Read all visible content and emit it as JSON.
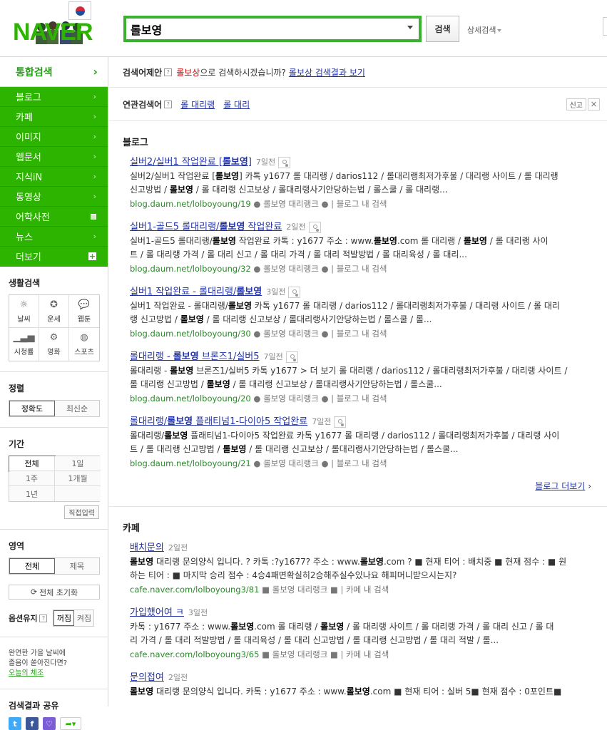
{
  "logo": {
    "text": "NAVER"
  },
  "search": {
    "value": "롤보영",
    "button": "검색",
    "detail": "상세검색"
  },
  "sidebar": {
    "head": "통합검색",
    "nav": [
      {
        "label": "블로그",
        "mark": "chevron"
      },
      {
        "label": "카페",
        "mark": "chevron"
      },
      {
        "label": "이미지",
        "mark": "chevron"
      },
      {
        "label": "웹문서",
        "mark": "chevron"
      },
      {
        "label": "지식iN",
        "mark": "chevron"
      },
      {
        "label": "동영상",
        "mark": "chevron"
      },
      {
        "label": "어학사전",
        "mark": "square"
      },
      {
        "label": "뉴스",
        "mark": "chevron"
      },
      {
        "label": "더보기",
        "mark": "plus"
      }
    ],
    "life_title": "생활검색",
    "life": [
      {
        "label": "날씨",
        "icon": "sun-icon",
        "glyph": "☼"
      },
      {
        "label": "운세",
        "icon": "star-icon",
        "glyph": "✪"
      },
      {
        "label": "웹툰",
        "icon": "speech-icon",
        "glyph": "💬"
      },
      {
        "label": "시청률",
        "icon": "bar-chart-icon",
        "glyph": "▁▃▅"
      },
      {
        "label": "영화",
        "icon": "film-reel-icon",
        "glyph": "⚙"
      },
      {
        "label": "스포츠",
        "icon": "ball-icon",
        "glyph": "◍"
      }
    ],
    "sort_title": "정렬",
    "sort": [
      "정확도",
      "최신순"
    ],
    "period_title": "기간",
    "period": [
      "전체",
      "1일",
      "1주",
      "1개월",
      "1년",
      ""
    ],
    "direct_input": "직접입력",
    "area_title": "영역",
    "area": [
      "전체",
      "제목"
    ],
    "reset": "전체 초기화",
    "keep_label": "옵션유지",
    "keep": [
      "꺼짐",
      "켜짐"
    ],
    "promo_line1": "완연한 가을 날씨에",
    "promo_line2": "졸음이 쏟아진다면?",
    "promo_link": "오늘의 체조",
    "share_title": "검색결과 공유"
  },
  "suggest": {
    "label": "검색어제안",
    "keyword": "롤보상",
    "text": "으로 검색하시겠습니까?",
    "link": "롤보상 검색결과 보기"
  },
  "related": {
    "label": "연관검색어",
    "keywords": [
      "롤 대리랭",
      "롤 대리"
    ],
    "report": "신고"
  },
  "blog": {
    "title": "블로그",
    "more": "블로그 더보기",
    "items": [
      {
        "title": "실버2/실버1 작업완료 [롤보영]",
        "age": "7일전",
        "desc1": "실버2/실버1 작업완료 [롤보영] 카톡 y1677 롤 대리랭 / darios112 / 롤대리랭최저가후불 / 대리랭 사이트 / 롤 대리랭",
        "desc2": "신고방법 / 롤보영 / 롤 대리랭 신고보상 / 롤대리랭사기안당하는법 / 롤스쿨 / 롤 대리랭...",
        "url": "blog.daum.net/lolboyoung/19",
        "tag": "롤보영 대리랭크",
        "inner": "블로그 내 검색"
      },
      {
        "title": "실버1-골드5 롤대리랭/롤보영 작업완료",
        "age": "2일전",
        "desc1": "실버1-골드5 롤대리랭/롤보영 작업완료 카톡 : y1677 주소 : www.롤보영.com 롤 대리랭 / 롤보영 / 롤 대리랭 사이",
        "desc2": "트 / 롤 대리랭 가격 / 롤 대리 신고 / 롤 대리 가격 / 롤 대리 적발방법 / 롤 대리육성 / 롤 대리...",
        "url": "blog.daum.net/lolboyoung/32",
        "tag": "롤보영 대리랭크",
        "inner": "블로그 내 검색"
      },
      {
        "title": "실버1 작업완료 - 롤대리랭/롤보영",
        "age": "3일전",
        "desc1": "실버1 작업완료 - 롤대리랭/롤보영 카톡 y1677 롤 대리랭 / darios112 / 롤대리랭최저가후불 / 대리랭 사이트 / 롤 대리",
        "desc2": "랭 신고방법 / 롤보영 / 롤 대리랭 신고보상 / 롤대리랭사기안당하는법 / 롤스쿨 / 롤...",
        "url": "blog.daum.net/lolboyoung/30",
        "tag": "롤보영 대리랭크",
        "inner": "블로그 내 검색"
      },
      {
        "title": "롤대리랭 - 롤보영 브론즈1/실버5",
        "age": "7일전",
        "desc1": "롤대리랭 - 롤보영 브론즈1/실버5 카톡 y1677 > 더 보기 롤 대리랭 / darios112 / 롤대리랭최저가후불 / 대리랭 사이트 /",
        "desc2": "롤 대리랭 신고방법 / 롤보영 / 롤 대리랭 신고보상 / 롤대리랭사기안당하는법 / 롤스쿨...",
        "url": "blog.daum.net/lolboyoung/20",
        "tag": "롤보영 대리랭크",
        "inner": "블로그 내 검색"
      },
      {
        "title": "롤대리랭/롤보영 플래티넘1-다이아5 작업완료",
        "age": "7일전",
        "desc1": "롤대리랭/롤보영 플래티넘1-다이아5 작업완료 카톡 y1677 롤 대리랭 / darios112 / 롤대리랭최저가후불 / 대리랭 사이",
        "desc2": "트 / 롤 대리랭 신고방법 / 롤보영 / 롤 대리랭 신고보상 / 롤대리랭사기안당하는법 / 롤스쿨...",
        "url": "blog.daum.net/lolboyoung/21",
        "tag": "롤보영 대리랭크",
        "inner": "블로그 내 검색"
      }
    ]
  },
  "cafe": {
    "title": "카페",
    "items": [
      {
        "title": "배치문의",
        "age": "2일전",
        "desc1": "롤보영 대리랭 문의양식 입니다. ? 카톡 :?y1677? 주소 : www.롤보영.com ? ■ 현재 티어 : 배치중 ■ 현재 점수 : ■ 원",
        "desc2": "하는 티어 : ■ 마지막 승리 점수 : 4승4패면확실히2승해주실수있나요 해피머니받으시는지?",
        "url": "cafe.naver.com/lolboyoung3/81",
        "tag": "롤보영 대리랭크",
        "inner": "카페 내 검색"
      },
      {
        "title": "가입했어여 ㅋ",
        "age": "3일전",
        "desc1": "카톡 : y1677 주소 : www.롤보영.com 롤 대리랭 / 롤보영 / 롤 대리랭 사이트 / 롤 대리랭 가격 / 롤 대리 신고 / 롤 대",
        "desc2": "리 가격 / 롤 대리 적발방법 / 롤 대리육성 / 롤 대리 신고방법 / 롤 대리랭 신고방법 / 롤 대리 적발 / 롤...",
        "url": "cafe.naver.com/lolboyoung3/65",
        "tag": "롤보영 대리랭크",
        "inner": "카페 내 검색"
      },
      {
        "title": "문의접여",
        "age": "2일전",
        "desc1": "롤보영 대리랭 문의양식 입니다. 카톡 : y1677 주소 : www.롤보영.com ■ 현재 티어 : 실버 5■ 현재 점수 : 0포인트■",
        "desc2": "",
        "url": "",
        "tag": "",
        "inner": ""
      }
    ]
  }
}
